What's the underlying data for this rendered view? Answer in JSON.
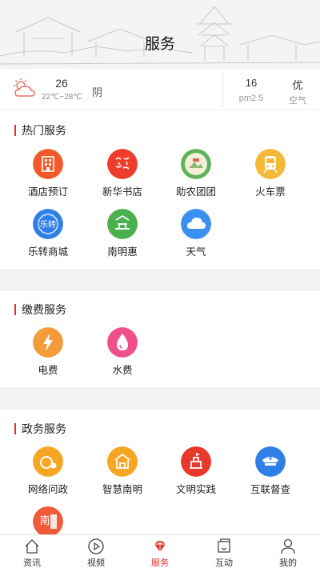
{
  "header": {
    "title": "服务"
  },
  "weather": {
    "temperature": "26",
    "range": "22℃~28℃",
    "condition": "阴",
    "pm_value": "16",
    "pm_label": "pm2.5",
    "air_value": "优",
    "air_label": "空气",
    "icon": "cloud-sun-icon"
  },
  "sections": [
    {
      "title": "热门服务",
      "items": [
        {
          "label": "酒店预订",
          "icon": "hotel-icon",
          "color": "#f25a2b"
        },
        {
          "label": "新华书店",
          "icon": "xinhua-bookstore-icon",
          "color": "#ef3d2c"
        },
        {
          "label": "助农团团",
          "icon": "farm-aid-icon",
          "color": "#5fb25a"
        },
        {
          "label": "火车票",
          "icon": "train-icon",
          "color": "#f5b93a"
        },
        {
          "label": "乐转商城",
          "icon": "mall-icon",
          "color": "#2f7fe8"
        },
        {
          "label": "南明惠",
          "icon": "nanminghui-icon",
          "color": "#4caf50"
        },
        {
          "label": "天气",
          "icon": "weather-cloud-icon",
          "color": "#3a8fef"
        }
      ]
    },
    {
      "title": "缴费服务",
      "items": [
        {
          "label": "电费",
          "icon": "lightning-icon",
          "color": "#f39c3c"
        },
        {
          "label": "水费",
          "icon": "water-drop-icon",
          "color": "#f0508a"
        }
      ]
    },
    {
      "title": "政务服务",
      "items": [
        {
          "label": "网络问政",
          "icon": "web-politics-icon",
          "color": "#f5a623"
        },
        {
          "label": "智慧南明",
          "icon": "smart-city-icon",
          "color": "#f5a623"
        },
        {
          "label": "文明实践",
          "icon": "civilization-icon",
          "color": "#e8372c"
        },
        {
          "label": "互联督查",
          "icon": "inspection-icon",
          "color": "#2f7fe8"
        },
        {
          "label": "",
          "icon": "nanming-logo-icon",
          "color": "#f05a3a"
        }
      ]
    }
  ],
  "tabbar": [
    {
      "label": "资讯",
      "icon": "home-icon",
      "active": false
    },
    {
      "label": "视频",
      "icon": "play-icon",
      "active": false
    },
    {
      "label": "服务",
      "icon": "diamond-icon",
      "active": true
    },
    {
      "label": "互动",
      "icon": "chat-icon",
      "active": false
    },
    {
      "label": "我的",
      "icon": "user-icon",
      "active": false
    }
  ],
  "colors": {
    "accent": "#e0302a",
    "divider_bg": "#f2f2f2"
  }
}
